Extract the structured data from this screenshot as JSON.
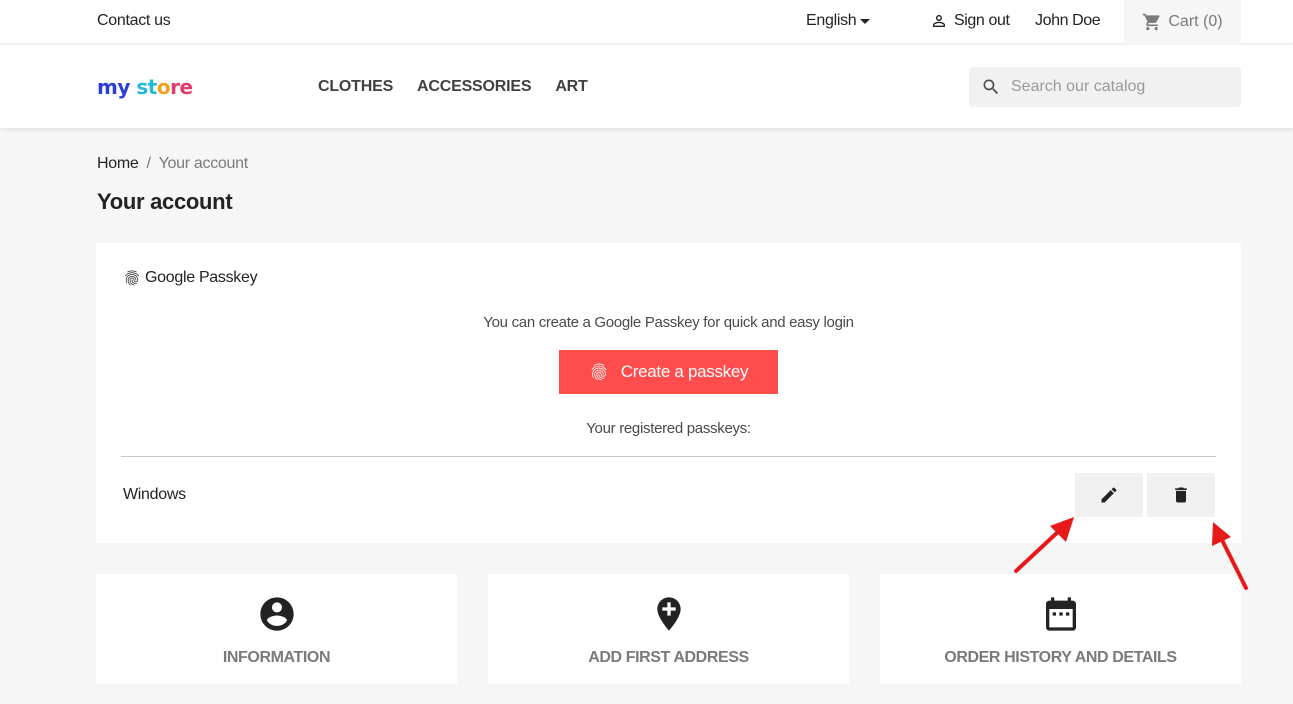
{
  "topbar": {
    "contact_label": "Contact us",
    "language": "English",
    "signout_label": "Sign out",
    "user_name": "John Doe",
    "cart_label": "Cart (0)"
  },
  "header": {
    "logo": {
      "part1": "my",
      "part2": "st",
      "part3": "o",
      "part4": "re"
    },
    "nav": [
      "CLOTHES",
      "ACCESSORIES",
      "ART"
    ],
    "search_placeholder": "Search our catalog"
  },
  "breadcrumb": {
    "home": "Home",
    "separator": "/",
    "current": "Your account"
  },
  "page_title": "Your account",
  "passkey": {
    "title": "Google Passkey",
    "description": "You can create a Google Passkey for quick and easy login",
    "create_button": "Create a passkey",
    "registered_label": "Your registered passkeys:",
    "items": [
      {
        "name": "Windows"
      }
    ]
  },
  "tiles": [
    {
      "label": "INFORMATION",
      "icon": "account-circle-icon"
    },
    {
      "label": "ADD FIRST ADDRESS",
      "icon": "add-location-icon"
    },
    {
      "label": "ORDER HISTORY AND DETAILS",
      "icon": "calendar-icon"
    }
  ],
  "colors": {
    "accent": "#ff4c4c",
    "annotation_arrow": "#e8191b",
    "background": "#f6f6f6",
    "card": "#ffffff"
  }
}
